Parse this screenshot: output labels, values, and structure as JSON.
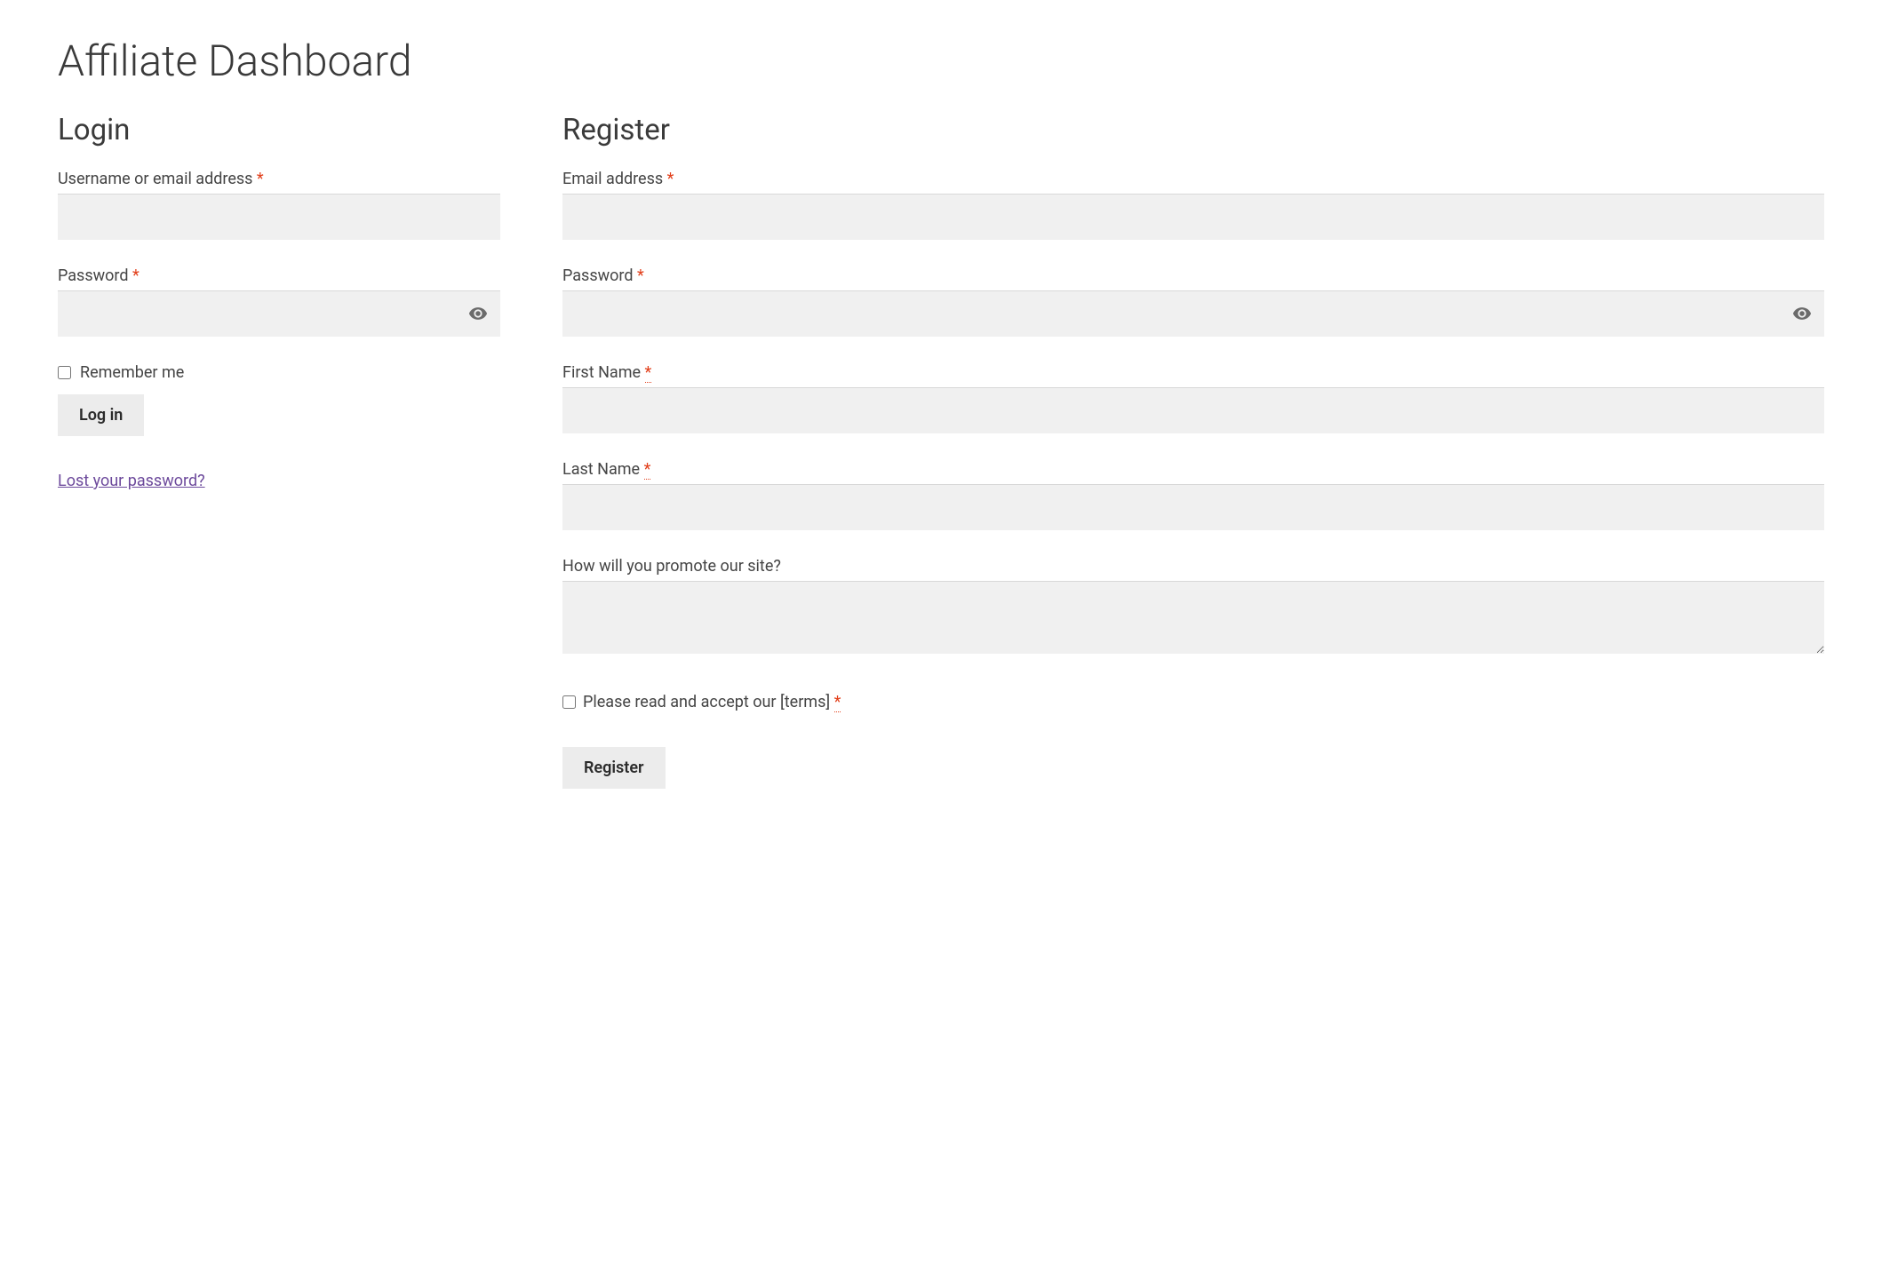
{
  "page": {
    "title": "Affiliate Dashboard"
  },
  "login": {
    "heading": "Login",
    "username_label": "Username or email address ",
    "password_label": "Password ",
    "remember_label": "Remember me",
    "button_label": "Log in",
    "lost_password_label": "Lost your password?",
    "required_marker": "*"
  },
  "register": {
    "heading": "Register",
    "email_label": "Email address ",
    "password_label": "Password ",
    "firstname_label": "First Name ",
    "lastname_label": "Last Name ",
    "promote_label": "How will you promote our site?",
    "terms_label": "Please read and accept our [terms] ",
    "button_label": "Register",
    "required_marker": "*"
  }
}
